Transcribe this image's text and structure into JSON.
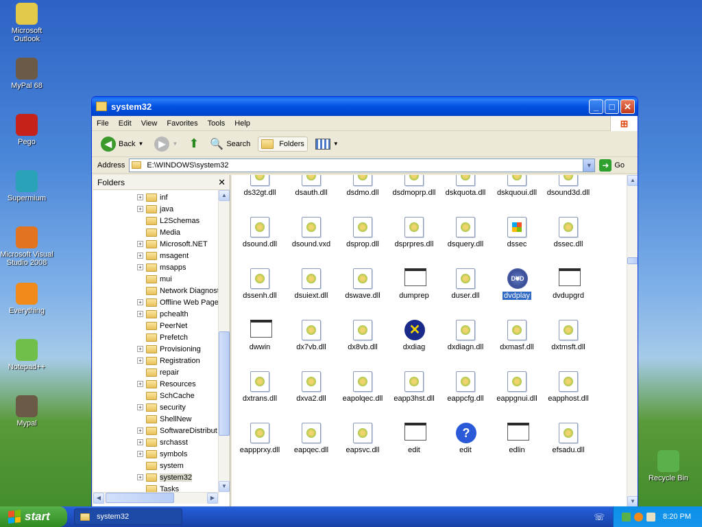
{
  "desktop": {
    "icons": [
      {
        "label": "Microsoft Outlook",
        "icon": "outlook-icon",
        "color": "#e3c94a"
      },
      {
        "label": "MyPal 68",
        "icon": "raccoon-icon",
        "color": "#6b5a45"
      },
      {
        "label": "Pego",
        "icon": "pego-icon",
        "color": "#c4221a"
      },
      {
        "label": "Supermium",
        "icon": "supermium-icon",
        "color": "#2aa3b8"
      },
      {
        "label": "Microsoft Visual Studio 2008",
        "icon": "visual-studio-icon",
        "color": "#e2741f"
      },
      {
        "label": "Everything",
        "icon": "magnifier-icon",
        "color": "#f08a1a"
      },
      {
        "label": "Notepad++",
        "icon": "notepad-icon",
        "color": "#6fbf4a"
      },
      {
        "label": "Mypal",
        "icon": "raccoon-icon",
        "color": "#6b5a45"
      },
      {
        "label": "Recycle Bin",
        "icon": "recycle-bin-icon",
        "color": "#5ab04a"
      }
    ]
  },
  "window": {
    "title": "system32",
    "menu": [
      "File",
      "Edit",
      "View",
      "Favorites",
      "Tools",
      "Help"
    ],
    "toolbar": {
      "back": "Back",
      "search": "Search",
      "folders": "Folders"
    },
    "address": {
      "label": "Address",
      "value": "E:\\WINDOWS\\system32",
      "go": "Go"
    },
    "folders_pane": {
      "title": "Folders",
      "items": [
        {
          "label": "inf",
          "expandable": true
        },
        {
          "label": "java",
          "expandable": true
        },
        {
          "label": "L2Schemas",
          "expandable": false
        },
        {
          "label": "Media",
          "expandable": false
        },
        {
          "label": "Microsoft.NET",
          "expandable": true
        },
        {
          "label": "msagent",
          "expandable": true
        },
        {
          "label": "msapps",
          "expandable": true
        },
        {
          "label": "mui",
          "expandable": false
        },
        {
          "label": "Network Diagnost",
          "expandable": false
        },
        {
          "label": "Offline Web Page",
          "expandable": true
        },
        {
          "label": "pchealth",
          "expandable": true
        },
        {
          "label": "PeerNet",
          "expandable": false
        },
        {
          "label": "Prefetch",
          "expandable": false
        },
        {
          "label": "Provisioning",
          "expandable": true
        },
        {
          "label": "Registration",
          "expandable": true
        },
        {
          "label": "repair",
          "expandable": false
        },
        {
          "label": "Resources",
          "expandable": true
        },
        {
          "label": "SchCache",
          "expandable": false
        },
        {
          "label": "security",
          "expandable": true
        },
        {
          "label": "ShellNew",
          "expandable": false
        },
        {
          "label": "SoftwareDistribut",
          "expandable": true
        },
        {
          "label": "srchasst",
          "expandable": true
        },
        {
          "label": "symbols",
          "expandable": true
        },
        {
          "label": "system",
          "expandable": false
        },
        {
          "label": "system32",
          "expandable": true,
          "selected": true
        },
        {
          "label": "Tasks",
          "expandable": false
        }
      ]
    },
    "files": [
      {
        "name": "ds32gt.dll",
        "type": "dll"
      },
      {
        "name": "dsauth.dll",
        "type": "dll"
      },
      {
        "name": "dsdmo.dll",
        "type": "dll"
      },
      {
        "name": "dsdmoprp.dll",
        "type": "dll"
      },
      {
        "name": "dskquota.dll",
        "type": "dll"
      },
      {
        "name": "dskquoui.dll",
        "type": "dll"
      },
      {
        "name": "dsound3d.dll",
        "type": "dll"
      },
      {
        "name": "dsound.dll",
        "type": "dll"
      },
      {
        "name": "dsound.vxd",
        "type": "dll"
      },
      {
        "name": "dsprop.dll",
        "type": "dll"
      },
      {
        "name": "dsprpres.dll",
        "type": "dll"
      },
      {
        "name": "dsquery.dll",
        "type": "dll"
      },
      {
        "name": "dssec",
        "type": "winlogo"
      },
      {
        "name": "dssec.dll",
        "type": "dll"
      },
      {
        "name": "dssenh.dll",
        "type": "dll"
      },
      {
        "name": "dsuiext.dll",
        "type": "dll"
      },
      {
        "name": "dswave.dll",
        "type": "dll"
      },
      {
        "name": "dumprep",
        "type": "window"
      },
      {
        "name": "duser.dll",
        "type": "dll"
      },
      {
        "name": "dvdplay",
        "type": "dvd",
        "selected": true
      },
      {
        "name": "dvdupgrd",
        "type": "window"
      },
      {
        "name": "dwwin",
        "type": "window"
      },
      {
        "name": "dx7vb.dll",
        "type": "dll"
      },
      {
        "name": "dx8vb.dll",
        "type": "dll"
      },
      {
        "name": "dxdiag",
        "type": "dxdiag"
      },
      {
        "name": "dxdiagn.dll",
        "type": "dll"
      },
      {
        "name": "dxmasf.dll",
        "type": "dll"
      },
      {
        "name": "dxtmsft.dll",
        "type": "dll"
      },
      {
        "name": "dxtrans.dll",
        "type": "dll"
      },
      {
        "name": "dxva2.dll",
        "type": "dll"
      },
      {
        "name": "eapolqec.dll",
        "type": "dll"
      },
      {
        "name": "eapp3hst.dll",
        "type": "dll"
      },
      {
        "name": "eappcfg.dll",
        "type": "dll"
      },
      {
        "name": "eappgnui.dll",
        "type": "dll"
      },
      {
        "name": "eapphost.dll",
        "type": "dll"
      },
      {
        "name": "eappprxy.dll",
        "type": "dll"
      },
      {
        "name": "eapqec.dll",
        "type": "dll"
      },
      {
        "name": "eapsvc.dll",
        "type": "dll"
      },
      {
        "name": "edit",
        "type": "window"
      },
      {
        "name": "edit",
        "type": "help"
      },
      {
        "name": "edlin",
        "type": "window"
      },
      {
        "name": "efsadu.dll",
        "type": "dll"
      }
    ]
  },
  "taskbar": {
    "start": "start",
    "task": "system32",
    "clock": "8:20 PM"
  },
  "colors": {
    "selection": "#316ac5",
    "titlebar": "#0052e0",
    "start": "#2f8c1f",
    "tray": "#0c8fe8"
  }
}
